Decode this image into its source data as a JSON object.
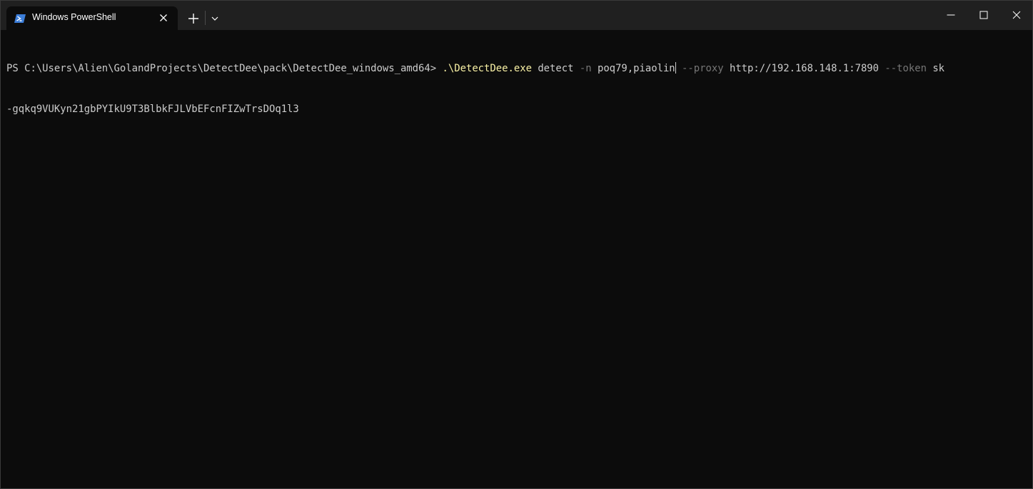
{
  "tab": {
    "title": "Windows PowerShell",
    "icon": "powershell-icon"
  },
  "titlebar": {
    "new_tab_icon": "plus-icon",
    "dropdown_icon": "chevron-down-icon",
    "minimize_icon": "minimize-icon",
    "maximize_icon": "maximize-icon",
    "close_icon": "close-icon"
  },
  "terminal": {
    "prompt": "PS C:\\Users\\Alien\\GolandProjects\\DetectDee\\pack\\DetectDee_windows_amd64> ",
    "command": ".\\DetectDee.exe",
    "arg_detect": " detect ",
    "flag_n": "-n",
    "value_n": " poq79,piaolin",
    "flag_proxy": " --proxy",
    "value_proxy": " http://192.168.148.1:7890 ",
    "flag_token": "--token",
    "value_token_part1": " sk",
    "value_token_part2": "-gqkq9VUKyn21gbPYIkU9T3BlbkFJLVbEFcnFIZwTrsDOq1l3"
  },
  "colors": {
    "background": "#0c0c0c",
    "titlebar": "#202020",
    "text": "#cccccc",
    "command": "#f9f1a5",
    "parameter": "#767676"
  }
}
